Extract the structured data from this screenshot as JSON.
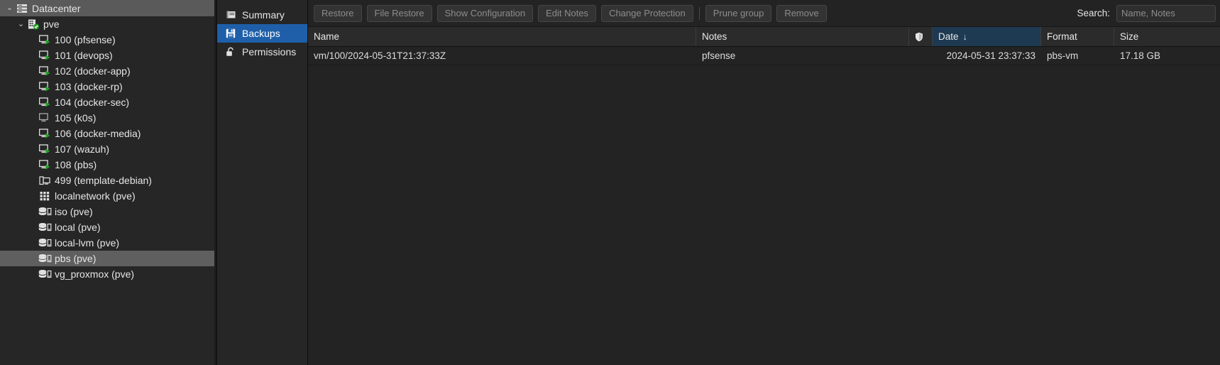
{
  "tree": {
    "items": [
      {
        "label": "Datacenter",
        "icon": "datacenter-icon",
        "depth": 0,
        "twisty": "⌄",
        "state": "root"
      },
      {
        "label": "pve",
        "icon": "node-online-icon",
        "depth": 1,
        "twisty": "⌄",
        "state": "normal"
      },
      {
        "label": "100 (pfsense)",
        "icon": "vm-running-icon",
        "depth": 2,
        "twisty": "",
        "state": "normal"
      },
      {
        "label": "101 (devops)",
        "icon": "vm-running-icon",
        "depth": 2,
        "twisty": "",
        "state": "normal"
      },
      {
        "label": "102 (docker-app)",
        "icon": "vm-running-icon",
        "depth": 2,
        "twisty": "",
        "state": "normal"
      },
      {
        "label": "103 (docker-rp)",
        "icon": "vm-running-icon",
        "depth": 2,
        "twisty": "",
        "state": "normal"
      },
      {
        "label": "104 (docker-sec)",
        "icon": "vm-running-icon",
        "depth": 2,
        "twisty": "",
        "state": "normal"
      },
      {
        "label": "105 (k0s)",
        "icon": "vm-stopped-icon",
        "depth": 2,
        "twisty": "",
        "state": "normal"
      },
      {
        "label": "106 (docker-media)",
        "icon": "vm-running-icon",
        "depth": 2,
        "twisty": "",
        "state": "normal"
      },
      {
        "label": "107 (wazuh)",
        "icon": "vm-running-icon",
        "depth": 2,
        "twisty": "",
        "state": "normal"
      },
      {
        "label": "108 (pbs)",
        "icon": "vm-running-icon",
        "depth": 2,
        "twisty": "",
        "state": "normal"
      },
      {
        "label": "499 (template-debian)",
        "icon": "vm-template-icon",
        "depth": 2,
        "twisty": "",
        "state": "normal"
      },
      {
        "label": "localnetwork (pve)",
        "icon": "network-icon",
        "depth": 2,
        "twisty": "",
        "state": "normal"
      },
      {
        "label": "iso (pve)",
        "icon": "storage-icon",
        "depth": 2,
        "twisty": "",
        "state": "normal"
      },
      {
        "label": "local (pve)",
        "icon": "storage-icon",
        "depth": 2,
        "twisty": "",
        "state": "normal"
      },
      {
        "label": "local-lvm (pve)",
        "icon": "storage-icon",
        "depth": 2,
        "twisty": "",
        "state": "normal"
      },
      {
        "label": "pbs (pve)",
        "icon": "storage-icon",
        "depth": 2,
        "twisty": "",
        "state": "selected"
      },
      {
        "label": "vg_proxmox (pve)",
        "icon": "storage-icon",
        "depth": 2,
        "twisty": "",
        "state": "normal"
      }
    ]
  },
  "nav": {
    "items": [
      {
        "label": "Summary",
        "icon": "summary-icon",
        "active": false
      },
      {
        "label": "Backups",
        "icon": "backups-icon",
        "active": true
      },
      {
        "label": "Permissions",
        "icon": "permissions-icon",
        "active": false
      }
    ]
  },
  "toolbar": {
    "buttons": [
      {
        "label": "Restore",
        "disabled": true,
        "separator_after": false
      },
      {
        "label": "File Restore",
        "disabled": true,
        "separator_after": false
      },
      {
        "label": "Show Configuration",
        "disabled": true,
        "separator_after": false
      },
      {
        "label": "Edit Notes",
        "disabled": true,
        "separator_after": false
      },
      {
        "label": "Change Protection",
        "disabled": true,
        "separator_after": true
      },
      {
        "label": "Prune group",
        "disabled": true,
        "separator_after": false
      },
      {
        "label": "Remove",
        "disabled": true,
        "separator_after": false
      }
    ],
    "search_label": "Search:",
    "search_value": "",
    "search_placeholder": "Name, Notes"
  },
  "table": {
    "columns": [
      {
        "key": "name",
        "label": "Name",
        "sorted": false,
        "sort_arrow": ""
      },
      {
        "key": "notes",
        "label": "Notes",
        "sorted": false,
        "sort_arrow": ""
      },
      {
        "key": "prot",
        "label": "",
        "sorted": false,
        "sort_arrow": "",
        "icon": "shield-icon"
      },
      {
        "key": "date",
        "label": "Date",
        "sorted": true,
        "sort_arrow": "↓"
      },
      {
        "key": "format",
        "label": "Format",
        "sorted": false,
        "sort_arrow": ""
      },
      {
        "key": "size",
        "label": "Size",
        "sorted": false,
        "sort_arrow": ""
      }
    ],
    "rows": [
      {
        "name": "vm/100/2024-05-31T21:37:33Z",
        "notes": "pfsense",
        "protected": false,
        "date": "2024-05-31 23:37:33",
        "format": "pbs-vm",
        "size": "17.18 GB"
      }
    ]
  },
  "colors": {
    "accent_blue": "#1f5fa9",
    "sorted_column": "#1e3a52",
    "running_green": "#21a121",
    "panel_bg": "#262626",
    "content_bg": "#232323"
  }
}
